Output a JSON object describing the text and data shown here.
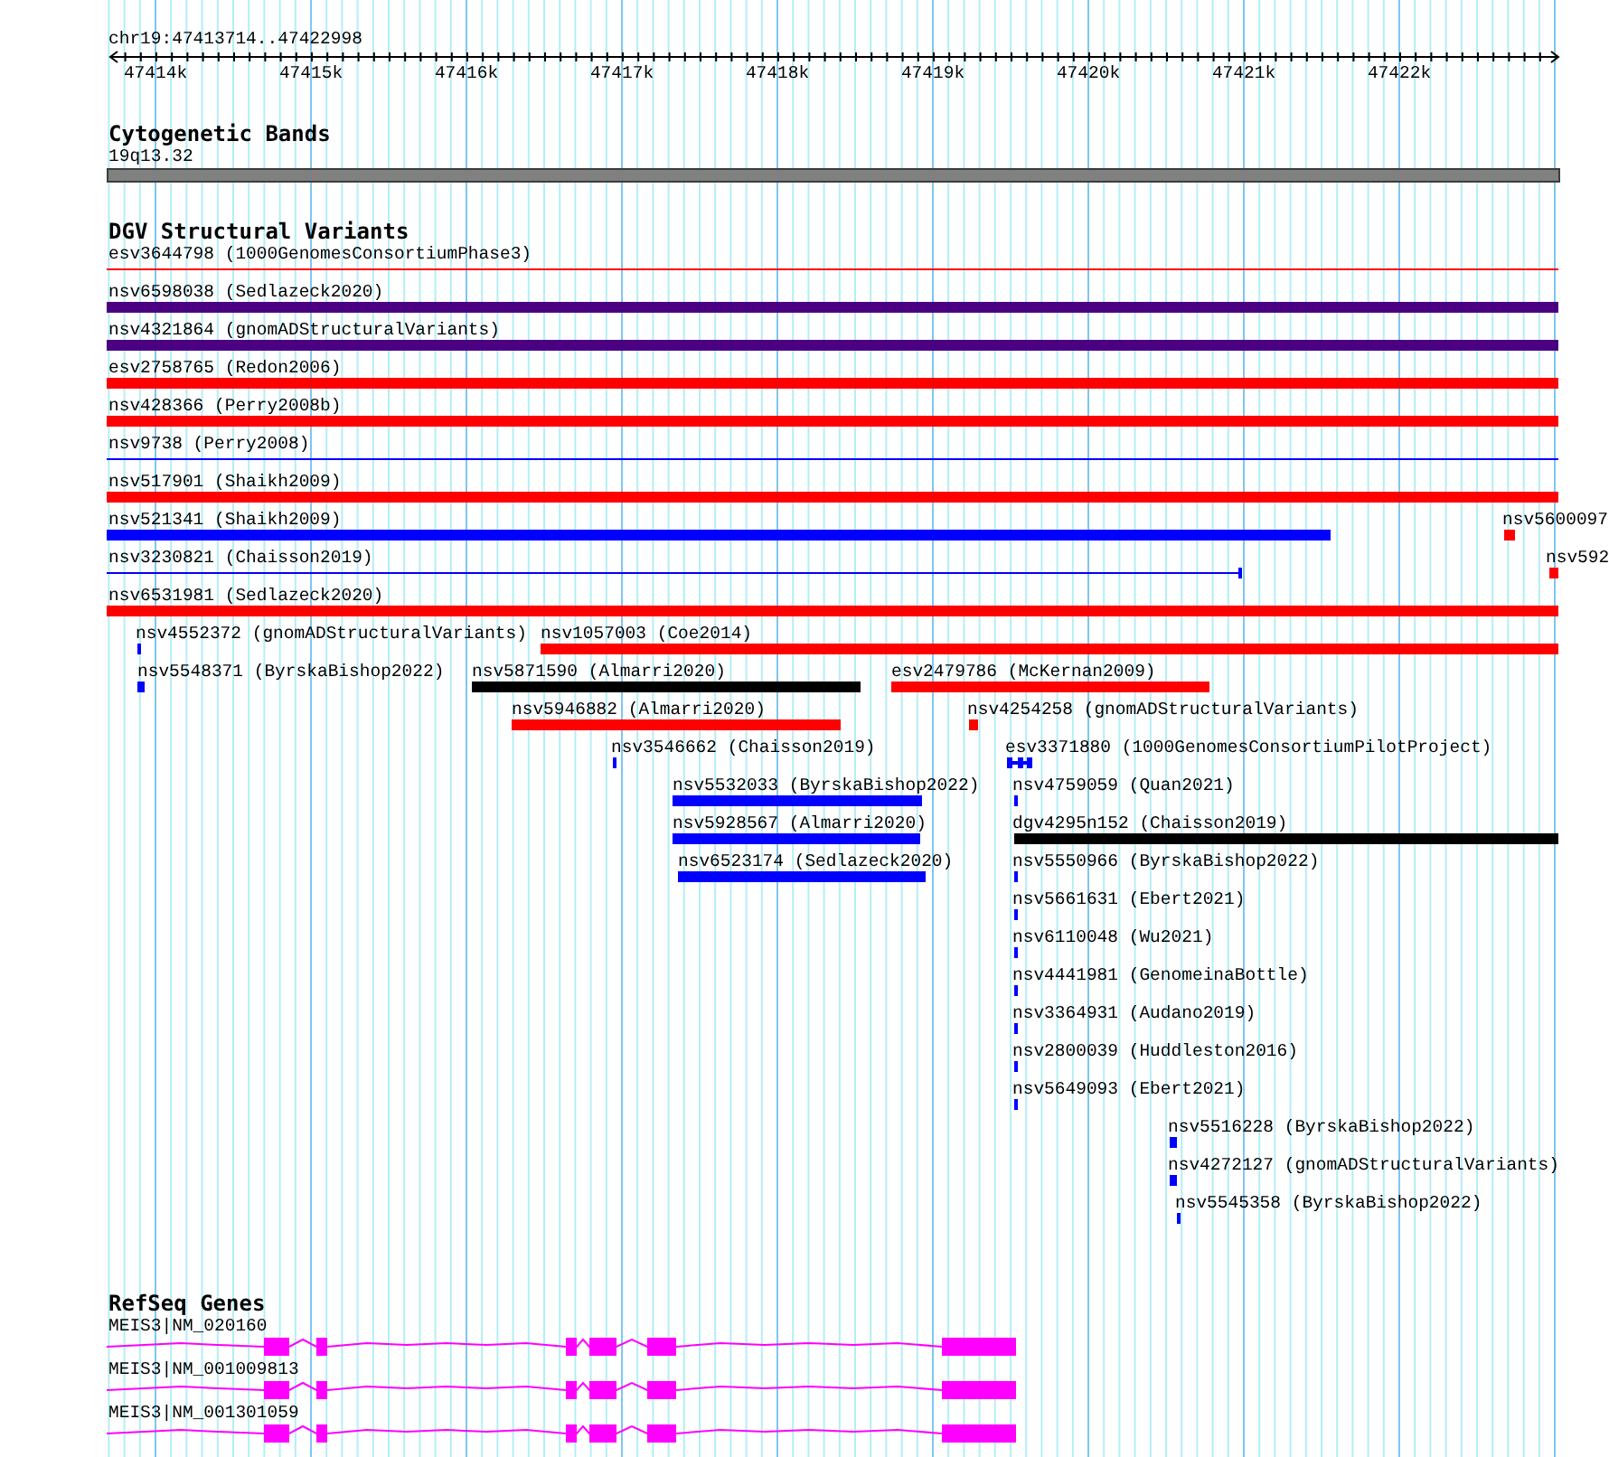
{
  "ruler": {
    "location": "chr19:47413714..47422998",
    "ticks": [
      "47414k",
      "47415k",
      "47416k",
      "47417k",
      "47418k",
      "47419k",
      "47420k",
      "47421k",
      "47422k"
    ]
  },
  "tracks": [
    {
      "kind": "cytobands",
      "title": "Cytogenetic Bands",
      "bands": [
        {
          "label": "19q13.32"
        }
      ]
    },
    {
      "kind": "variants",
      "title": "DGV Structural Variants",
      "features": [
        {
          "label": "esv3644798 (1000GenomesConsortiumPhase3)",
          "kind": "line",
          "color": "#ff0000"
        },
        {
          "label": "nsv6598038 (Sedlazeck2020)",
          "kind": "bar",
          "color": "#4b0082"
        },
        {
          "label": "nsv4321864 (gnomADStructuralVariants)",
          "kind": "bar",
          "color": "#4b0082"
        },
        {
          "label": "esv2758765 (Redon2006)",
          "kind": "bar",
          "color": "#ff0000"
        },
        {
          "label": "nsv428366 (Perry2008b)",
          "kind": "bar",
          "color": "#ff0000"
        },
        {
          "label": "nsv9738 (Perry2008)",
          "kind": "line",
          "color": "#0000ff"
        },
        {
          "label": "nsv517901 (Shaikh2009)",
          "kind": "bar",
          "color": "#ff0000"
        },
        {
          "label": "nsv521341 (Shaikh2009)",
          "kind": "bar",
          "color": "#0000ff"
        },
        {
          "label": "nsv5600097",
          "kind": "bar",
          "color": "#ff0000"
        },
        {
          "label": "nsv3230821 (Chaisson2019)",
          "kind": "line",
          "color": "#0000ff"
        },
        {
          "label": "nsv592",
          "kind": "bar",
          "color": "#ff0000"
        },
        {
          "label": "nsv6531981 (Sedlazeck2020)",
          "kind": "bar",
          "color": "#ff0000"
        },
        {
          "label": "nsv4552372 (gnomADStructuralVariants)",
          "kind": "bar",
          "color": "#0000ff"
        },
        {
          "label": "nsv1057003 (Coe2014)",
          "kind": "bar",
          "color": "#ff0000"
        },
        {
          "label": "nsv5548371 (ByrskaBishop2022)",
          "kind": "bar",
          "color": "#0000ff"
        },
        {
          "label": "nsv5871590 (Almarri2020)",
          "kind": "bar",
          "color": "#000000"
        },
        {
          "label": "esv2479786 (McKernan2009)",
          "kind": "bar",
          "color": "#ff0000"
        },
        {
          "label": "nsv5946882 (Almarri2020)",
          "kind": "bar",
          "color": "#ff0000"
        },
        {
          "label": "nsv4254258 (gnomADStructuralVariants)",
          "kind": "bar",
          "color": "#ff0000"
        },
        {
          "label": "nsv3546662 (Chaisson2019)",
          "kind": "bar",
          "color": "#0000ff"
        },
        {
          "label": "esv3371880 (1000GenomesConsortiumPilotProject)",
          "kind": "split",
          "color": "#0000ff"
        },
        {
          "label": "nsv5532033 (ByrskaBishop2022)",
          "kind": "bar",
          "color": "#0000ff"
        },
        {
          "label": "nsv4759059 (Quan2021)",
          "kind": "bar",
          "color": "#0000ff"
        },
        {
          "label": "nsv5928567 (Almarri2020)",
          "kind": "bar",
          "color": "#0000ff"
        },
        {
          "label": "dgv4295n152 (Chaisson2019)",
          "kind": "bar",
          "color": "#000000"
        },
        {
          "label": "nsv6523174 (Sedlazeck2020)",
          "kind": "bar",
          "color": "#0000ff"
        },
        {
          "label": "nsv5550966 (ByrskaBishop2022)",
          "kind": "bar",
          "color": "#0000ff"
        },
        {
          "label": "nsv5661631 (Ebert2021)",
          "kind": "bar",
          "color": "#0000ff"
        },
        {
          "label": "nsv6110048 (Wu2021)",
          "kind": "bar",
          "color": "#0000ff"
        },
        {
          "label": "nsv4441981 (GenomeinaBottle)",
          "kind": "bar",
          "color": "#0000ff"
        },
        {
          "label": "nsv3364931 (Audano2019)",
          "kind": "bar",
          "color": "#0000ff"
        },
        {
          "label": "nsv2800039 (Huddleston2016)",
          "kind": "bar",
          "color": "#0000ff"
        },
        {
          "label": "nsv5649093 (Ebert2021)",
          "kind": "bar",
          "color": "#0000ff"
        },
        {
          "label": "nsv5516228 (ByrskaBishop2022)",
          "kind": "bar",
          "color": "#0000ff"
        },
        {
          "label": "nsv4272127 (gnomADStructuralVariants)",
          "kind": "bar",
          "color": "#0000ff"
        },
        {
          "label": "nsv5545358 (ByrskaBishop2022)",
          "kind": "bar",
          "color": "#0000ff"
        }
      ]
    },
    {
      "kind": "genes",
      "title": "RefSeq Genes",
      "genes": [
        {
          "label": "MEIS3|NM_020160"
        },
        {
          "label": "MEIS3|NM_001009813"
        },
        {
          "label": "MEIS3|NM_001301059"
        }
      ]
    }
  ]
}
